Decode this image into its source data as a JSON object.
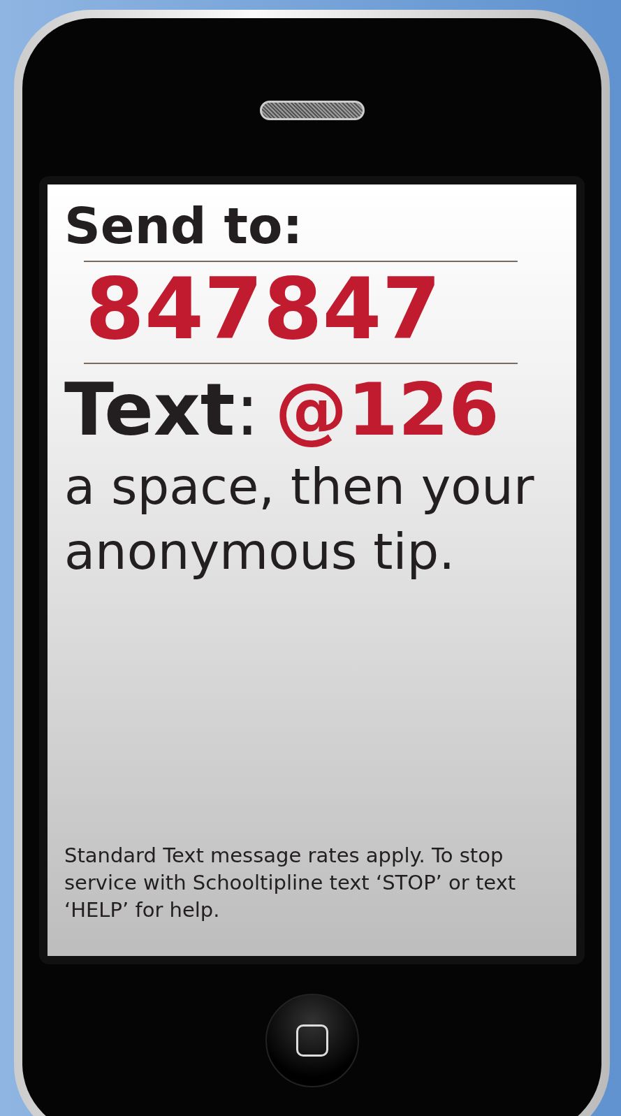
{
  "screen": {
    "send_label": "Send to:",
    "number": "847847",
    "text_label": "**Text**:",
    "code": "@126",
    "instruction": "a space, then your anonymous tip.",
    "disclaimer": "Standard Text message rates apply. To stop service with Schooltipline text ‘STOP’ or text ‘HELP’ for help."
  }
}
